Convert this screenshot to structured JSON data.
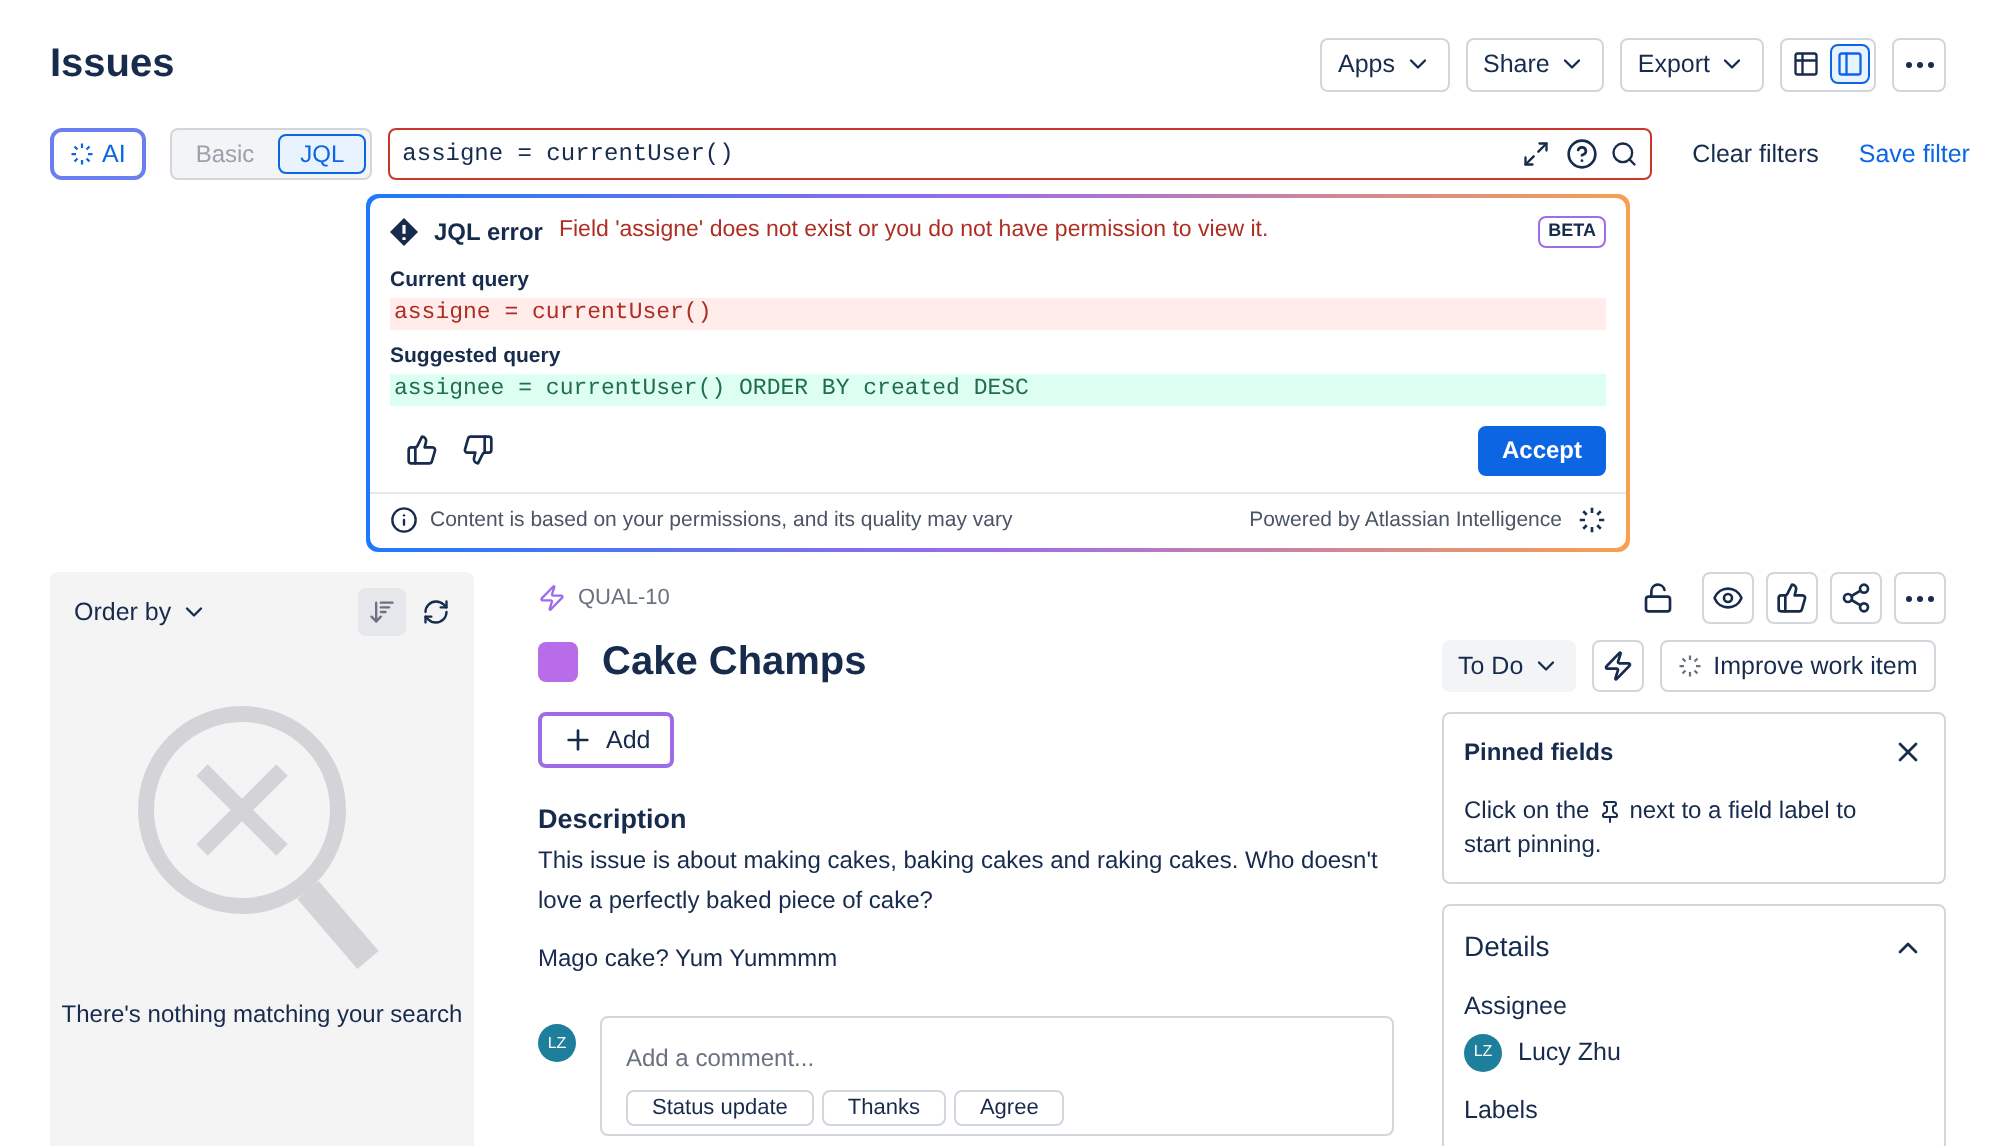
{
  "page_title": "Issues",
  "header_buttons": [
    {
      "label": "Apps",
      "kind": "dropdown"
    },
    {
      "label": "Share",
      "kind": "dropdown"
    },
    {
      "label": "Export",
      "kind": "dropdown"
    }
  ],
  "view_toggle": [
    {
      "kind": "list",
      "selected": false
    },
    {
      "kind": "detail",
      "selected": true
    }
  ],
  "ai_button": {
    "label": "AI"
  },
  "mode_tabs": [
    {
      "label": "Basic",
      "selected": false
    },
    {
      "label": "JQL",
      "selected": true
    }
  ],
  "query_field": {
    "value": "assigne = currentUser()",
    "error": true
  },
  "clear_filters": "Clear filters",
  "save_filter": "Save filter",
  "jql_popover": {
    "title": "JQL error",
    "message": "Field 'assigne' does not exist or you do not have permission to view it.",
    "badge": "BETA",
    "current_label": "Current query",
    "current_query": "assigne = currentUser()",
    "suggested_label": "Suggested query",
    "suggested_query": "assignee = currentUser() ORDER BY created DESC",
    "accept": "Accept",
    "footer_note": "Content is based on your permissions, and its quality may vary",
    "powered_by": "Powered by Atlassian Intelligence"
  },
  "list_panel": {
    "order_by": "Order by",
    "empty_message": "There's nothing matching your search"
  },
  "issue": {
    "key": "QUAL-10",
    "title": "Cake Champs",
    "add": "Add",
    "description_heading": "Description",
    "description": "This issue is about making cakes, baking cakes and raking cakes. Who doesn't love a perfectly baked piece of cake?",
    "note": "Mago cake? Yum Yummmm",
    "comment": {
      "avatar": "LZ",
      "placeholder": "Add a comment...",
      "quick_replies": [
        "Status update",
        "Thanks",
        "Agree"
      ]
    }
  },
  "side": {
    "status": "To Do",
    "improve": "Improve work item",
    "pinned_title": "Pinned fields",
    "pinned_text_before": "Click on the",
    "pinned_text_after": "next to a field label to",
    "pinned_text_end": "start pinning.",
    "details_title": "Details",
    "details_expanded": true,
    "fields": [
      {
        "label": "Assignee",
        "avatar": "LZ",
        "value": "Lucy Zhu"
      },
      {
        "label": "Labels"
      }
    ]
  }
}
